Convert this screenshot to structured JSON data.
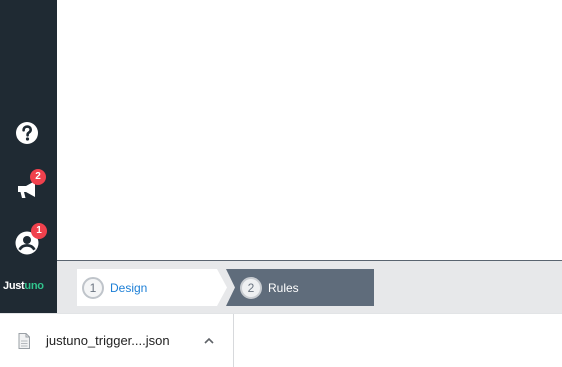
{
  "sidebar": {
    "icons": [
      "help-icon",
      "announcements-icon",
      "account-icon"
    ],
    "announcements_badge": "2",
    "account_badge": "1",
    "logo_prefix": "Just",
    "logo_suffix": "uno"
  },
  "steps": [
    {
      "number": "1",
      "label": "Design",
      "state": "available"
    },
    {
      "number": "2",
      "label": "Rules",
      "state": "active"
    }
  ],
  "downloads": {
    "file_name": "justuno_trigger....json"
  },
  "colors": {
    "sidebar_bg": "#1f2a33",
    "badge": "#f0414d",
    "step_active_bg": "#5f6c7b",
    "step_link": "#1d7fd6",
    "logo_accent": "#31c48d"
  }
}
